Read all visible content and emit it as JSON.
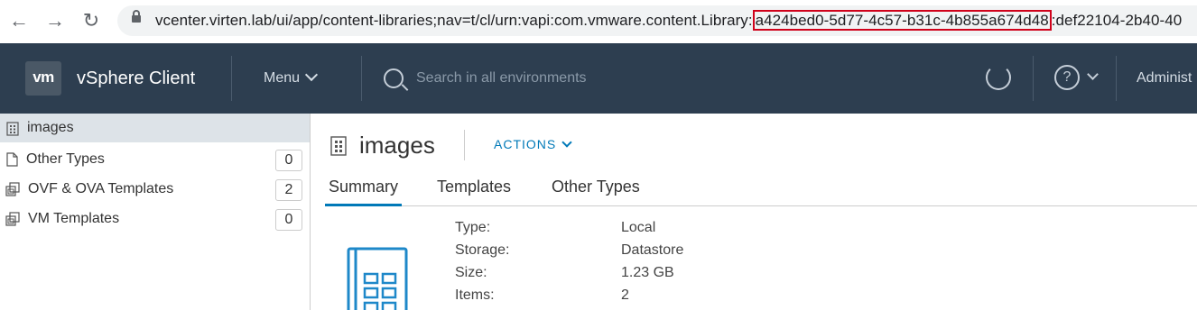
{
  "browser": {
    "url_prefix": "vcenter.virten.lab/ui/app/content-libraries;nav=t/cl/urn:vapi:com.vmware.content.Library:",
    "url_highlight": "a424bed0-5d77-4c57-b31c-4b855a674d48",
    "url_suffix": ":def22104-2b40-40",
    "highlight_color": "#d0021b"
  },
  "header": {
    "logo": "vm",
    "title": "vSphere Client",
    "menu": "Menu",
    "search_placeholder": "Search in all environments",
    "user": "Administ",
    "help_glyph": "?",
    "background": "#2d3e50"
  },
  "tree": {
    "root": "images",
    "items": [
      {
        "label": "Other Types",
        "count": "0",
        "icon": "file-icon"
      },
      {
        "label": "OVF & OVA Templates",
        "count": "2",
        "icon": "ovf-template-icon"
      },
      {
        "label": "VM Templates",
        "count": "0",
        "icon": "vm-template-icon"
      }
    ]
  },
  "main": {
    "title": "images",
    "actions": "ACTIONS",
    "tabs": [
      "Summary",
      "Templates",
      "Other Types"
    ],
    "active_tab": "Summary",
    "accent": "#0079b8",
    "summary": [
      {
        "label": "Type:",
        "value": "Local"
      },
      {
        "label": "Storage:",
        "value": "Datastore"
      },
      {
        "label": "Size:",
        "value": "1.23 GB"
      },
      {
        "label": "Items:",
        "value": "2"
      }
    ]
  }
}
